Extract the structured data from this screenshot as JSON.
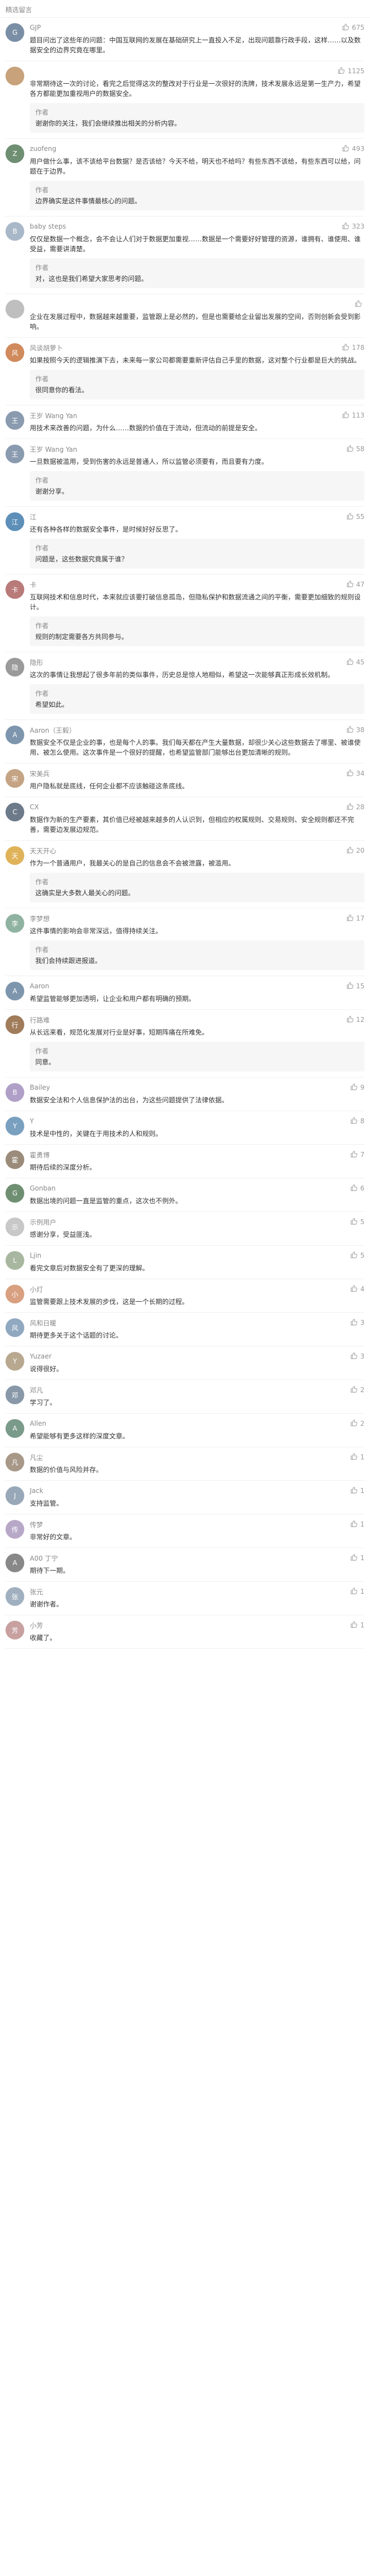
{
  "header": {
    "title": "精选留言"
  },
  "icons": {
    "like": "thumbs-up-icon"
  },
  "comments": [
    {
      "name": "GJP",
      "likes": "675",
      "avatar_color": "#7a8fa6",
      "avatar_text": "G",
      "text": "题目问出了这些年的问题：中国互联网的发展在基础研究上一直投入不足，出现问题靠行政手段，这样……以及数据安全的边界究竟在哪里。",
      "reply_author": "",
      "reply_text": ""
    },
    {
      "name": "",
      "likes": "1125",
      "avatar_color": "#c7a27a",
      "avatar_text": "",
      "text": "非常期待这一次的讨论，看完之后觉得这次的整改对于行业是一次很好的洗牌，技术发展永远是第一生产力，希望各方都能更加重视用户的数据安全。",
      "reply_author": "作者",
      "reply_text": "谢谢你的关注，我们会继续推出相关的分析内容。"
    },
    {
      "name": "zuofeng",
      "likes": "493",
      "avatar_color": "#6f8f72",
      "avatar_text": "Z",
      "text": "用户做什么事，该不该给平台数据？是否该给？今天不给，明天也不给吗？有些东西不该给，有些东西可以给，问题在于边界。",
      "reply_author": "作者",
      "reply_text": "边界确实是这件事情最核心的问题。"
    },
    {
      "name": "baby steps",
      "likes": "323",
      "avatar_color": "#a9b8c8",
      "avatar_text": "B",
      "text": "仅仅是数据一个概念，会不会让人们对于数据更加重视……数据是一个需要好好管理的资源，谁拥有、谁使用、谁受益，需要讲清楚。",
      "reply_author": "作者",
      "reply_text": "对，这也是我们希望大家思考的问题。"
    },
    {
      "name": "",
      "likes": "",
      "avatar_color": "#bfbfbf",
      "avatar_text": "",
      "text": "企业在发展过程中，数据越来越重要，监管跟上是必然的，但是也需要给企业留出发展的空间，否则创新会受到影响。",
      "reply_author": "",
      "reply_text": ""
    },
    {
      "name": "风谈胡萝卜",
      "likes": "178",
      "avatar_color": "#d08a5c",
      "avatar_text": "风",
      "text": "如果按照今天的逻辑推演下去，未来每一家公司都需要重新评估自己手里的数据，这对整个行业都是巨大的挑战。",
      "reply_author": "作者",
      "reply_text": "很同意你的看法。"
    },
    {
      "name": "王岁 Wang Yan",
      "likes": "113",
      "avatar_color": "#8a9bb0",
      "avatar_text": "王",
      "text": "用技术来改善的问题，为什么……数据的价值在于流动，但流动的前提是安全。",
      "reply_author": "",
      "reply_text": ""
    },
    {
      "name": "王岁 Wang Yan",
      "likes": "58",
      "avatar_color": "#8a9bb0",
      "avatar_text": "王",
      "text": "一旦数据被滥用，受到伤害的永远是普通人，所以监管必须要有，而且要有力度。",
      "reply_author": "作者",
      "reply_text": "谢谢分享。"
    },
    {
      "name": "江",
      "likes": "55",
      "avatar_color": "#5d8fb8",
      "avatar_text": "江",
      "text": "还有各种各样的数据安全事件，是时候好好反思了。",
      "reply_author": "作者",
      "reply_text": "问题是，这些数据究竟属于谁？"
    },
    {
      "name": "卡",
      "likes": "47",
      "avatar_color": "#b97a7a",
      "avatar_text": "卡",
      "text": "互联网技术和信息时代，本来就应该要打破信息孤岛，但隐私保护和数据流通之间的平衡，需要更加细致的规则设计。",
      "reply_author": "作者",
      "reply_text": "规则的制定需要各方共同参与。"
    },
    {
      "name": "隐形",
      "likes": "45",
      "avatar_color": "#9a9a9a",
      "avatar_text": "隐",
      "text": "这次的事情让我想起了很多年前的类似事件，历史总是惊人地相似，希望这一次能够真正形成长效机制。",
      "reply_author": "作者",
      "reply_text": "希望如此。"
    },
    {
      "name": "Aaron（王毅）",
      "likes": "38",
      "avatar_color": "#7e96ad",
      "avatar_text": "A",
      "text": "数据安全不仅是企业的事，也是每个人的事。我们每天都在产生大量数据，却很少关心这些数据去了哪里、被谁使用、被怎么使用。这次事件是一个很好的提醒，也希望监管部门能够出台更加清晰的规则。",
      "reply_author": "",
      "reply_text": ""
    },
    {
      "name": "宋美兵",
      "likes": "34",
      "avatar_color": "#c4a484",
      "avatar_text": "宋",
      "text": "用户隐私就是底线，任何企业都不应该触碰这条底线。",
      "reply_author": "",
      "reply_text": ""
    },
    {
      "name": "CX",
      "likes": "28",
      "avatar_color": "#6c7a89",
      "avatar_text": "C",
      "text": "数据作为新的生产要素，其价值已经被越来越多的人认识到，但相应的权属规则、交易规则、安全规则都还不完善，需要边发展边规范。",
      "reply_author": "",
      "reply_text": ""
    },
    {
      "name": "天天开心",
      "likes": "20",
      "avatar_color": "#e0b35a",
      "avatar_text": "天",
      "text": "作为一个普通用户，我最关心的是自己的信息会不会被泄露，被滥用。",
      "reply_author": "作者",
      "reply_text": "这确实是大多数人最关心的问题。"
    },
    {
      "name": "李梦想",
      "likes": "17",
      "avatar_color": "#8fb3a0",
      "avatar_text": "李",
      "text": "这件事情的影响会非常深远，值得持续关注。",
      "reply_author": "作者",
      "reply_text": "我们会持续跟进报道。"
    },
    {
      "name": "Aaron",
      "likes": "15",
      "avatar_color": "#7e96ad",
      "avatar_text": "A",
      "text": "希望监管能够更加透明，让企业和用户都有明确的预期。",
      "reply_author": "",
      "reply_text": ""
    },
    {
      "name": "行路难",
      "likes": "12",
      "avatar_color": "#a07c5b",
      "avatar_text": "行",
      "text": "从长远来看，规范化发展对行业是好事，短期阵痛在所难免。",
      "reply_author": "作者",
      "reply_text": "同意。"
    },
    {
      "name": "Bailey",
      "likes": "9",
      "avatar_color": "#b0a0c8",
      "avatar_text": "B",
      "text": "数据安全法和个人信息保护法的出台，为这些问题提供了法律依据。",
      "reply_author": "",
      "reply_text": ""
    },
    {
      "name": "Y",
      "likes": "8",
      "avatar_color": "#7aa0c0",
      "avatar_text": "Y",
      "text": "技术是中性的，关键在于用技术的人和规则。",
      "reply_author": "",
      "reply_text": ""
    },
    {
      "name": "霍勇博",
      "likes": "7",
      "avatar_color": "#9b8b7a",
      "avatar_text": "霍",
      "text": "期待后续的深度分析。",
      "reply_author": "",
      "reply_text": ""
    },
    {
      "name": "Gonban",
      "likes": "6",
      "avatar_color": "#6f8f72",
      "avatar_text": "G",
      "text": "数据出境的问题一直是监管的重点，这次也不例外。",
      "reply_author": "",
      "reply_text": ""
    },
    {
      "name": "示例用户",
      "likes": "5",
      "avatar_color": "#c8c8c8",
      "avatar_text": "示",
      "text": "感谢分享，受益匪浅。",
      "reply_author": "",
      "reply_text": ""
    },
    {
      "name": "Ljin",
      "likes": "5",
      "avatar_color": "#a8b8a0",
      "avatar_text": "L",
      "text": "看完文章后对数据安全有了更深的理解。",
      "reply_author": "",
      "reply_text": ""
    },
    {
      "name": "小灯",
      "likes": "4",
      "avatar_color": "#d8a080",
      "avatar_text": "小",
      "text": "监管需要跟上技术发展的步伐，这是一个长期的过程。",
      "reply_author": "",
      "reply_text": ""
    },
    {
      "name": "风和日暖",
      "likes": "3",
      "avatar_color": "#90a8c0",
      "avatar_text": "风",
      "text": "期待更多关于这个话题的讨论。",
      "reply_author": "",
      "reply_text": ""
    },
    {
      "name": "Yuzaer",
      "likes": "3",
      "avatar_color": "#b8a890",
      "avatar_text": "Y",
      "text": "说得很好。",
      "reply_author": "",
      "reply_text": ""
    },
    {
      "name": "邓凡",
      "likes": "2",
      "avatar_color": "#8898a8",
      "avatar_text": "邓",
      "text": "学习了。",
      "reply_author": "",
      "reply_text": ""
    },
    {
      "name": "Allen",
      "likes": "2",
      "avatar_color": "#7a9a8a",
      "avatar_text": "A",
      "text": "希望能够有更多这样的深度文章。",
      "reply_author": "",
      "reply_text": ""
    },
    {
      "name": "凡尘",
      "likes": "1",
      "avatar_color": "#a89888",
      "avatar_text": "凡",
      "text": "数据的价值与风险并存。",
      "reply_author": "",
      "reply_text": ""
    },
    {
      "name": "Jack",
      "likes": "1",
      "avatar_color": "#98a8b8",
      "avatar_text": "J",
      "text": "支持监管。",
      "reply_author": "",
      "reply_text": ""
    },
    {
      "name": "传梦",
      "likes": "1",
      "avatar_color": "#b8a8c8",
      "avatar_text": "传",
      "text": "非常好的文章。",
      "reply_author": "",
      "reply_text": ""
    },
    {
      "name": "A00 丁宁",
      "likes": "1",
      "avatar_color": "#888888",
      "avatar_text": "A",
      "text": "期待下一期。",
      "reply_author": "",
      "reply_text": ""
    },
    {
      "name": "张元",
      "likes": "1",
      "avatar_color": "#a0b0c0",
      "avatar_text": "张",
      "text": "谢谢作者。",
      "reply_author": "",
      "reply_text": ""
    },
    {
      "name": "小芳",
      "likes": "1",
      "avatar_color": "#c8a0a0",
      "avatar_text": "芳",
      "text": "收藏了。",
      "reply_author": "",
      "reply_text": ""
    }
  ]
}
